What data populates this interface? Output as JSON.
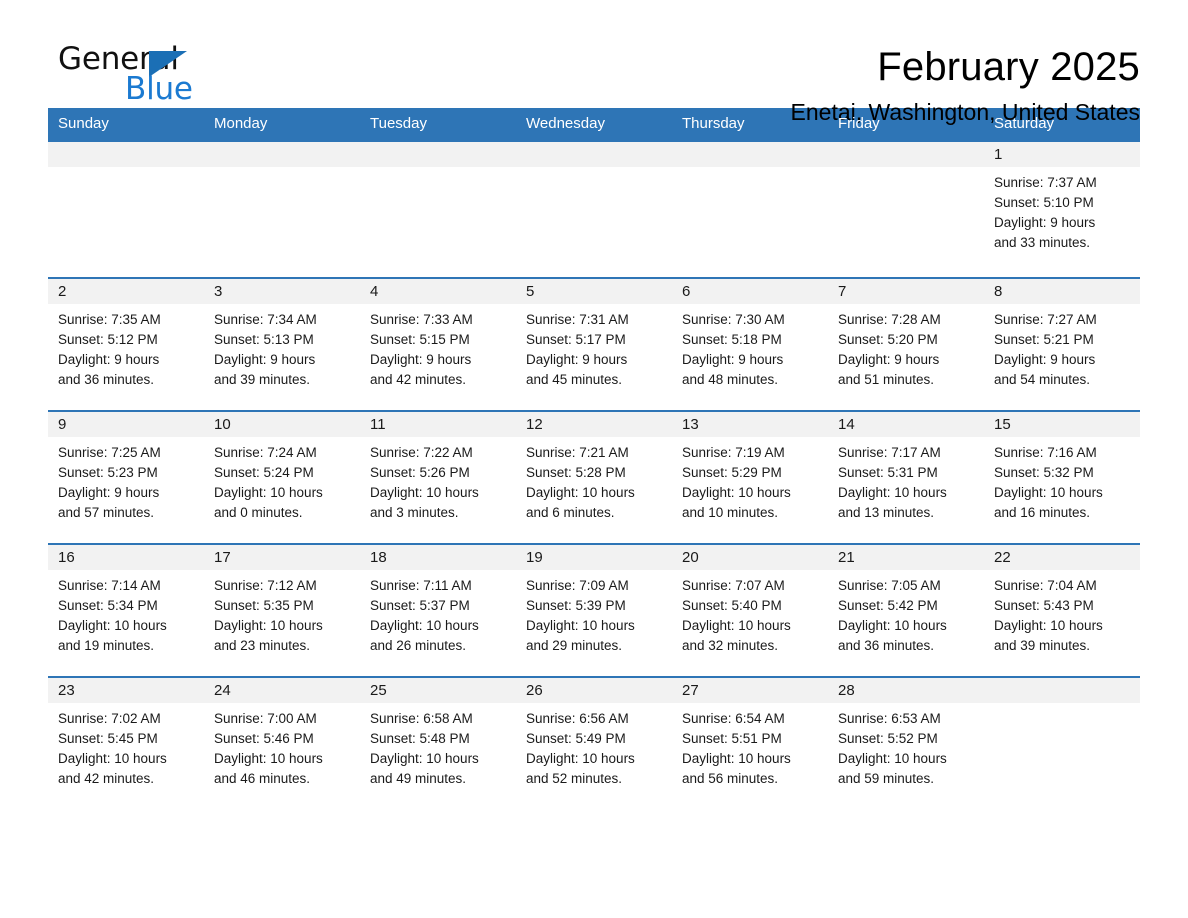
{
  "brand": {
    "name_part1": "General",
    "name_part2": "Blue",
    "accent_color": "#1b7ad1",
    "triangle_color": "#1b6fb5"
  },
  "header": {
    "month_title": "February 2025",
    "location": "Enetai, Washington, United States",
    "header_bg_color": "#2e75b6",
    "row_divider_color": "#2e75b6",
    "daynum_band_color": "#f2f2f2"
  },
  "weekday_headers": [
    "Sunday",
    "Monday",
    "Tuesday",
    "Wednesday",
    "Thursday",
    "Friday",
    "Saturday"
  ],
  "weeks": [
    [
      {
        "day": "",
        "sunrise": "",
        "sunset": "",
        "daylight1": "",
        "daylight2": ""
      },
      {
        "day": "",
        "sunrise": "",
        "sunset": "",
        "daylight1": "",
        "daylight2": ""
      },
      {
        "day": "",
        "sunrise": "",
        "sunset": "",
        "daylight1": "",
        "daylight2": ""
      },
      {
        "day": "",
        "sunrise": "",
        "sunset": "",
        "daylight1": "",
        "daylight2": ""
      },
      {
        "day": "",
        "sunrise": "",
        "sunset": "",
        "daylight1": "",
        "daylight2": ""
      },
      {
        "day": "",
        "sunrise": "",
        "sunset": "",
        "daylight1": "",
        "daylight2": ""
      },
      {
        "day": "1",
        "sunrise": "Sunrise: 7:37 AM",
        "sunset": "Sunset: 5:10 PM",
        "daylight1": "Daylight: 9 hours",
        "daylight2": "and 33 minutes."
      }
    ],
    [
      {
        "day": "2",
        "sunrise": "Sunrise: 7:35 AM",
        "sunset": "Sunset: 5:12 PM",
        "daylight1": "Daylight: 9 hours",
        "daylight2": "and 36 minutes."
      },
      {
        "day": "3",
        "sunrise": "Sunrise: 7:34 AM",
        "sunset": "Sunset: 5:13 PM",
        "daylight1": "Daylight: 9 hours",
        "daylight2": "and 39 minutes."
      },
      {
        "day": "4",
        "sunrise": "Sunrise: 7:33 AM",
        "sunset": "Sunset: 5:15 PM",
        "daylight1": "Daylight: 9 hours",
        "daylight2": "and 42 minutes."
      },
      {
        "day": "5",
        "sunrise": "Sunrise: 7:31 AM",
        "sunset": "Sunset: 5:17 PM",
        "daylight1": "Daylight: 9 hours",
        "daylight2": "and 45 minutes."
      },
      {
        "day": "6",
        "sunrise": "Sunrise: 7:30 AM",
        "sunset": "Sunset: 5:18 PM",
        "daylight1": "Daylight: 9 hours",
        "daylight2": "and 48 minutes."
      },
      {
        "day": "7",
        "sunrise": "Sunrise: 7:28 AM",
        "sunset": "Sunset: 5:20 PM",
        "daylight1": "Daylight: 9 hours",
        "daylight2": "and 51 minutes."
      },
      {
        "day": "8",
        "sunrise": "Sunrise: 7:27 AM",
        "sunset": "Sunset: 5:21 PM",
        "daylight1": "Daylight: 9 hours",
        "daylight2": "and 54 minutes."
      }
    ],
    [
      {
        "day": "9",
        "sunrise": "Sunrise: 7:25 AM",
        "sunset": "Sunset: 5:23 PM",
        "daylight1": "Daylight: 9 hours",
        "daylight2": "and 57 minutes."
      },
      {
        "day": "10",
        "sunrise": "Sunrise: 7:24 AM",
        "sunset": "Sunset: 5:24 PM",
        "daylight1": "Daylight: 10 hours",
        "daylight2": "and 0 minutes."
      },
      {
        "day": "11",
        "sunrise": "Sunrise: 7:22 AM",
        "sunset": "Sunset: 5:26 PM",
        "daylight1": "Daylight: 10 hours",
        "daylight2": "and 3 minutes."
      },
      {
        "day": "12",
        "sunrise": "Sunrise: 7:21 AM",
        "sunset": "Sunset: 5:28 PM",
        "daylight1": "Daylight: 10 hours",
        "daylight2": "and 6 minutes."
      },
      {
        "day": "13",
        "sunrise": "Sunrise: 7:19 AM",
        "sunset": "Sunset: 5:29 PM",
        "daylight1": "Daylight: 10 hours",
        "daylight2": "and 10 minutes."
      },
      {
        "day": "14",
        "sunrise": "Sunrise: 7:17 AM",
        "sunset": "Sunset: 5:31 PM",
        "daylight1": "Daylight: 10 hours",
        "daylight2": "and 13 minutes."
      },
      {
        "day": "15",
        "sunrise": "Sunrise: 7:16 AM",
        "sunset": "Sunset: 5:32 PM",
        "daylight1": "Daylight: 10 hours",
        "daylight2": "and 16 minutes."
      }
    ],
    [
      {
        "day": "16",
        "sunrise": "Sunrise: 7:14 AM",
        "sunset": "Sunset: 5:34 PM",
        "daylight1": "Daylight: 10 hours",
        "daylight2": "and 19 minutes."
      },
      {
        "day": "17",
        "sunrise": "Sunrise: 7:12 AM",
        "sunset": "Sunset: 5:35 PM",
        "daylight1": "Daylight: 10 hours",
        "daylight2": "and 23 minutes."
      },
      {
        "day": "18",
        "sunrise": "Sunrise: 7:11 AM",
        "sunset": "Sunset: 5:37 PM",
        "daylight1": "Daylight: 10 hours",
        "daylight2": "and 26 minutes."
      },
      {
        "day": "19",
        "sunrise": "Sunrise: 7:09 AM",
        "sunset": "Sunset: 5:39 PM",
        "daylight1": "Daylight: 10 hours",
        "daylight2": "and 29 minutes."
      },
      {
        "day": "20",
        "sunrise": "Sunrise: 7:07 AM",
        "sunset": "Sunset: 5:40 PM",
        "daylight1": "Daylight: 10 hours",
        "daylight2": "and 32 minutes."
      },
      {
        "day": "21",
        "sunrise": "Sunrise: 7:05 AM",
        "sunset": "Sunset: 5:42 PM",
        "daylight1": "Daylight: 10 hours",
        "daylight2": "and 36 minutes."
      },
      {
        "day": "22",
        "sunrise": "Sunrise: 7:04 AM",
        "sunset": "Sunset: 5:43 PM",
        "daylight1": "Daylight: 10 hours",
        "daylight2": "and 39 minutes."
      }
    ],
    [
      {
        "day": "23",
        "sunrise": "Sunrise: 7:02 AM",
        "sunset": "Sunset: 5:45 PM",
        "daylight1": "Daylight: 10 hours",
        "daylight2": "and 42 minutes."
      },
      {
        "day": "24",
        "sunrise": "Sunrise: 7:00 AM",
        "sunset": "Sunset: 5:46 PM",
        "daylight1": "Daylight: 10 hours",
        "daylight2": "and 46 minutes."
      },
      {
        "day": "25",
        "sunrise": "Sunrise: 6:58 AM",
        "sunset": "Sunset: 5:48 PM",
        "daylight1": "Daylight: 10 hours",
        "daylight2": "and 49 minutes."
      },
      {
        "day": "26",
        "sunrise": "Sunrise: 6:56 AM",
        "sunset": "Sunset: 5:49 PM",
        "daylight1": "Daylight: 10 hours",
        "daylight2": "and 52 minutes."
      },
      {
        "day": "27",
        "sunrise": "Sunrise: 6:54 AM",
        "sunset": "Sunset: 5:51 PM",
        "daylight1": "Daylight: 10 hours",
        "daylight2": "and 56 minutes."
      },
      {
        "day": "28",
        "sunrise": "Sunrise: 6:53 AM",
        "sunset": "Sunset: 5:52 PM",
        "daylight1": "Daylight: 10 hours",
        "daylight2": "and 59 minutes."
      },
      {
        "day": "",
        "sunrise": "",
        "sunset": "",
        "daylight1": "",
        "daylight2": ""
      }
    ]
  ]
}
